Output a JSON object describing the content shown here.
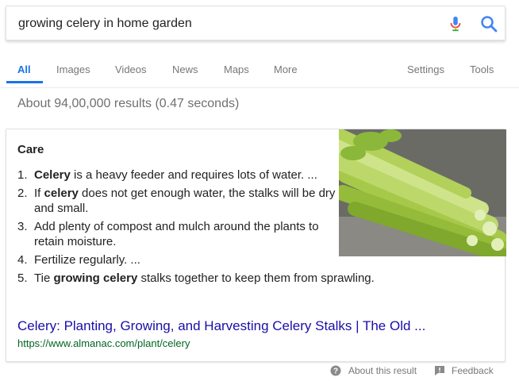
{
  "search": {
    "query": "growing celery in home garden"
  },
  "tabs": {
    "items": [
      "All",
      "Images",
      "Videos",
      "News",
      "Maps",
      "More"
    ],
    "right": [
      "Settings",
      "Tools"
    ],
    "active": "All"
  },
  "stats": "About 94,00,000 results (0.47 seconds)",
  "snippet": {
    "title": "Care",
    "steps": [
      {
        "num": "1.",
        "parts": [
          {
            "t": "Celery",
            "b": true
          },
          {
            "t": " is a heavy feeder and requires lots of water. ...",
            "b": false
          }
        ]
      },
      {
        "num": "2.",
        "parts": [
          {
            "t": "If ",
            "b": false
          },
          {
            "t": "celery",
            "b": true
          },
          {
            "t": " does not get enough water, the stalks will be dry and small.",
            "b": false
          }
        ]
      },
      {
        "num": "3.",
        "parts": [
          {
            "t": "Add plenty of compost and mulch around the plants to retain moisture.",
            "b": false
          }
        ]
      },
      {
        "num": "4.",
        "parts": [
          {
            "t": "Fertilize regularly. ...",
            "b": false
          }
        ]
      },
      {
        "num": "5.",
        "parts": [
          {
            "t": "Tie ",
            "b": false
          },
          {
            "t": "growing celery",
            "b": true
          },
          {
            "t": " stalks together to keep them from sprawling.",
            "b": false
          }
        ]
      }
    ],
    "link_title": "Celery: Planting, Growing, and Harvesting Celery Stalks | The Old ...",
    "link_url": "https://www.almanac.com/plant/celery",
    "image_icon": "celery-photo"
  },
  "footer": {
    "about": "About this result",
    "feedback": "Feedback"
  },
  "colors": {
    "accent": "#1a73e8",
    "link": "#1a0dab",
    "url": "#006621"
  }
}
